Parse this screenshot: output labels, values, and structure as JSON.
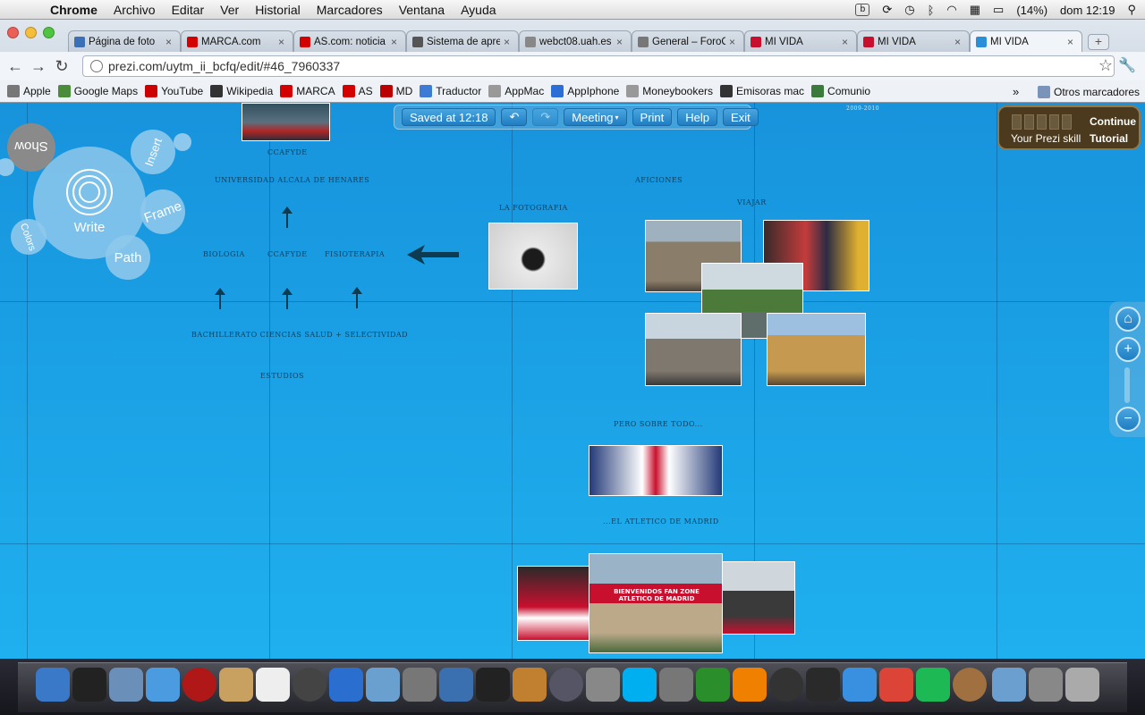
{
  "menubar": {
    "app": "Chrome",
    "items": [
      "Archivo",
      "Editar",
      "Ver",
      "Historial",
      "Marcadores",
      "Ventana",
      "Ayuda"
    ],
    "battery": "(14%)",
    "clock": "dom 12:19"
  },
  "tabs": [
    {
      "title": "Página de foto",
      "icon": "image-icon",
      "color": "#3b6fb6"
    },
    {
      "title": "MARCA.com",
      "icon": "marca-icon",
      "color": "#d40000"
    },
    {
      "title": "AS.com: noticia",
      "icon": "as-icon",
      "color": "#d40000"
    },
    {
      "title": "Sistema de apre",
      "icon": "person-icon",
      "color": "#555555"
    },
    {
      "title": "webct08.uah.es",
      "icon": "page-icon",
      "color": "#888888"
    },
    {
      "title": "General – ForoC",
      "icon": "globe-icon",
      "color": "#777777"
    },
    {
      "title": "MI VIDA",
      "icon": "prezi-icon",
      "color": "#c8102e"
    },
    {
      "title": "MI VIDA",
      "icon": "prezi-icon",
      "color": "#c8102e"
    },
    {
      "title": "MI VIDA",
      "icon": "prezi-icon",
      "color": "#2a8fd8"
    }
  ],
  "omnibox": {
    "url": "prezi.com/uytm_ii_bcfq/edit/#46_7960337"
  },
  "bookmarks": {
    "items": [
      {
        "label": "Apple",
        "icon": "apple-icon"
      },
      {
        "label": "Google Maps",
        "icon": "maps-icon"
      },
      {
        "label": "YouTube",
        "icon": "youtube-icon"
      },
      {
        "label": "Wikipedia",
        "icon": "wikipedia-icon"
      },
      {
        "label": "MARCA",
        "icon": "marca-icon"
      },
      {
        "label": "AS",
        "icon": "as-icon"
      },
      {
        "label": "MD",
        "icon": "md-icon"
      },
      {
        "label": "Traductor",
        "icon": "translate-icon"
      },
      {
        "label": "AppMac",
        "icon": "page-icon"
      },
      {
        "label": "AppIphone",
        "icon": "appiphone-icon"
      },
      {
        "label": "Moneybookers",
        "icon": "moneybookers-icon"
      },
      {
        "label": "Emisoras mac",
        "icon": "radio-icon"
      },
      {
        "label": "Comunio",
        "icon": "comunio-icon"
      }
    ],
    "more": "»",
    "other": "Otros marcadores"
  },
  "prezi_toolbar": {
    "saved": "Saved at 12:18",
    "meeting": "Meeting",
    "print": "Print",
    "help": "Help",
    "exit": "Exit"
  },
  "skill": {
    "label": "Your Prezi skill",
    "action": "Continue Tutorial"
  },
  "wheel": {
    "write": "Write",
    "show": "Show",
    "insert": "Insert",
    "frame": "Frame",
    "path": "Path",
    "colors": "Colors"
  },
  "canvas": {
    "year_tag": "2009-2010",
    "ccafyde_top": "CCAFYDE",
    "universidad": "UNIVERSIDAD ALCALA DE HENARES",
    "biologia": "BIOLOGIA",
    "ccafyde": "CCAFYDE",
    "fisioterapia": "FISIOTERAPIA",
    "bachillerato": "BACHILLERATO CIENCIAS SALUD + SELECTIVIDAD",
    "estudios": "ESTUDIOS",
    "fotografia": "LA FOTOGRAFIA",
    "aficiones": "AFICIONES",
    "viajar": "VIAJAR",
    "pero": "PERO SOBRE TODO...",
    "atletico": "...EL ATLETICO DE MADRID",
    "banner": "BIENVENIDOS FAN ZONE ATLETICO DE MADRID"
  },
  "dock": [
    "Finder",
    "Dashboard",
    "Preview",
    "FaceTime",
    "Photo Booth",
    "Address Book",
    "iCal",
    "DVD Player",
    "iTunes",
    "iPhoto",
    "Image Capture",
    "DVD",
    "iMovie",
    "GarageBand",
    "Mission Control",
    "System Preferences",
    "Skype",
    "Automator",
    "Downloader",
    "VLC",
    "Time Machine",
    "Camera",
    "Messenger",
    "Chrome",
    "Spotify",
    "Archive",
    "Folder",
    "Documents",
    "Trash"
  ],
  "colors": {
    "canvas": "#1a9be6",
    "accent": "#1f7ec3",
    "text_dark": "#0b3f5e"
  }
}
